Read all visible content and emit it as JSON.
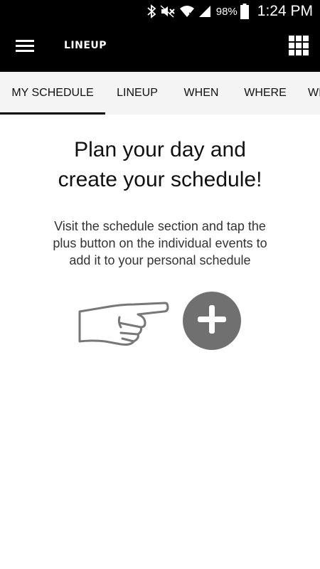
{
  "status_bar": {
    "battery": "98%",
    "time": "1:24 PM",
    "icons": [
      "bluetooth-icon",
      "mute-icon",
      "wifi-icon",
      "signal-icon",
      "battery-icon"
    ]
  },
  "app_bar": {
    "title": "LINEUP",
    "icons": [
      "menu-icon",
      "grid-icon"
    ]
  },
  "tabs": {
    "items": [
      {
        "label": "MY SCHEDULE",
        "active": true
      },
      {
        "label": "LINEUP",
        "active": false
      },
      {
        "label": "WHEN",
        "active": false
      },
      {
        "label": "WHERE",
        "active": false
      },
      {
        "label": "WI",
        "active": false
      }
    ]
  },
  "empty_state": {
    "headline_line1": "Plan your day and",
    "headline_line2": "create your schedule!",
    "desc_line1": "Visit the schedule section and tap the",
    "desc_line2": "plus button on the individual events to",
    "desc_line3": "add it to your personal schedule",
    "illustration_icons": [
      "pointing-hand-icon",
      "plus-icon"
    ]
  },
  "colors": {
    "bar_background": "#000000",
    "tab_background": "#f4f4f4",
    "plus_button": "#707070"
  }
}
